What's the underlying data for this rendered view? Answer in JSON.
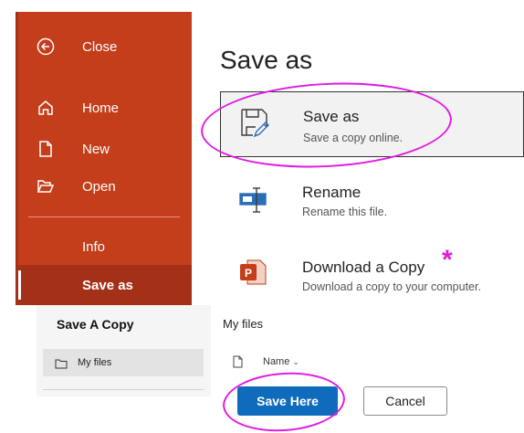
{
  "sidebar": {
    "close_label": "Close",
    "home_label": "Home",
    "new_label": "New",
    "open_label": "Open",
    "info_label": "Info",
    "saveas_label": "Save as"
  },
  "main": {
    "title": "Save as",
    "options": [
      {
        "title": "Save as",
        "subtitle": "Save a copy online.",
        "icon": "save-as-icon"
      },
      {
        "title": "Rename",
        "subtitle": "Rename this file.",
        "icon": "rename-icon"
      },
      {
        "title": "Download a Copy",
        "subtitle": "Download a copy to your computer.",
        "icon": "powerpoint-file-icon"
      }
    ],
    "annotation_mark": "*"
  },
  "dialog": {
    "title": "Save A Copy",
    "locations": [
      {
        "label": "My files",
        "icon": "folder-icon"
      }
    ],
    "files_title": "My files",
    "name_column": "Name",
    "sort_icon": "chevron-down-icon",
    "save_label": "Save Here",
    "cancel_label": "Cancel"
  },
  "colors": {
    "sidebar_bg": "#c43e1c",
    "sidebar_selected": "#a33017",
    "primary_button": "#0f6cbd",
    "annotation": "#e11ae1"
  }
}
